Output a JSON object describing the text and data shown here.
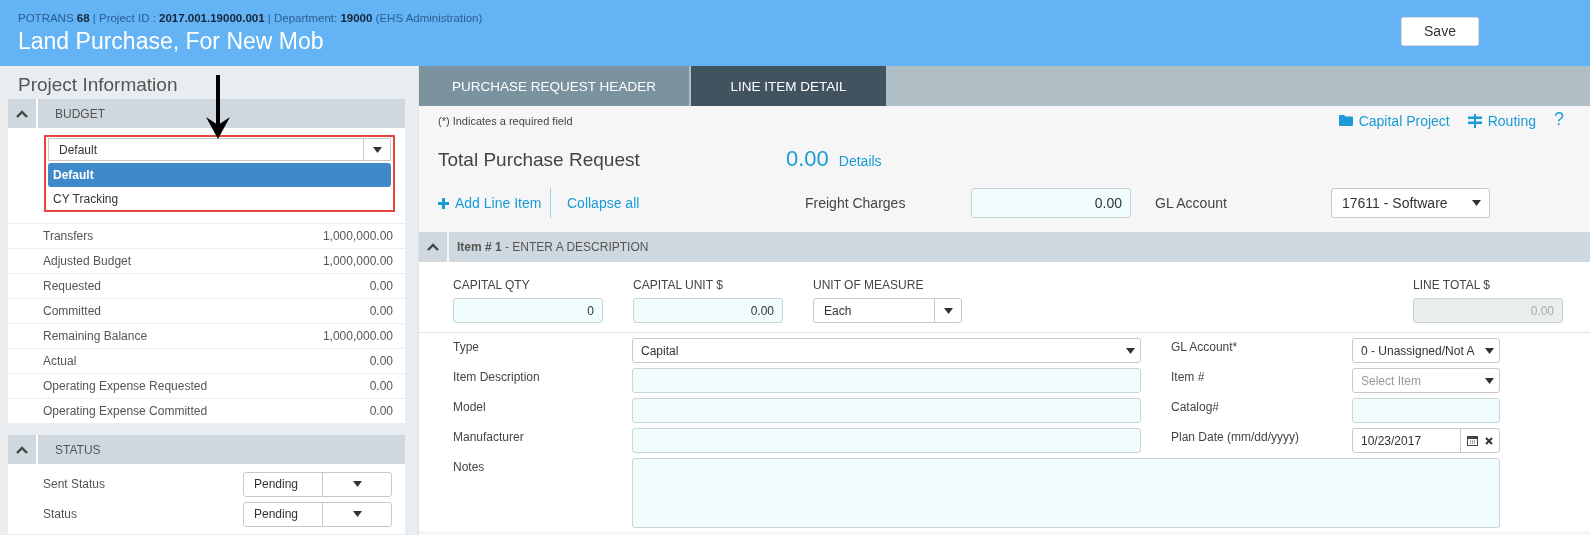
{
  "header": {
    "breadcrumb": "POTRANS **68** | Project ID : **2017.001.19000.001** | Department: **19000** (EHS Administration)",
    "title": "Land Purchase, For New Mob",
    "save_button": "Save"
  },
  "sidebar": {
    "title": "Project Information",
    "budget": {
      "heading": "BUDGET",
      "expanded": true,
      "select": {
        "value": "Default",
        "open": true,
        "options": [
          {
            "label": "Default",
            "selected": true
          },
          {
            "label": "CY Tracking",
            "selected": false
          }
        ]
      },
      "rows": [
        {
          "label": "Transfers",
          "value": "1,000,000.00"
        },
        {
          "label": "Adjusted Budget",
          "value": "1,000,000.00"
        },
        {
          "label": "Requested",
          "value": "0.00"
        },
        {
          "label": "Committed",
          "value": "0.00"
        },
        {
          "label": "Remaining Balance",
          "value": "1,000,000.00"
        },
        {
          "label": "Actual",
          "value": "0.00"
        },
        {
          "label": "Operating Expense Requested",
          "value": "0.00"
        },
        {
          "label": "Operating Expense Committed",
          "value": "0.00"
        }
      ]
    },
    "status": {
      "heading": "STATUS",
      "expanded": true,
      "fields": [
        {
          "label": "Sent Status",
          "value": "Pending"
        },
        {
          "label": "Status",
          "value": "Pending"
        }
      ]
    }
  },
  "tabs": [
    {
      "label": "PURCHASE REQUEST HEADER",
      "selected": false
    },
    {
      "label": "LINE ITEM DETAIL",
      "selected": true
    }
  ],
  "form": {
    "required_note": "(*) Indicates a required field",
    "links": [
      {
        "kind": "folder",
        "label": "Capital Project"
      },
      {
        "kind": "signpost",
        "label": "Routing"
      },
      {
        "kind": "help",
        "label": "?"
      }
    ],
    "total": {
      "label": "Total Purchase Request",
      "amount": "0.00",
      "details_link": "Details"
    },
    "add_link": "Add Line Item",
    "collapse_link": "Collapse all",
    "freight": {
      "label": "Freight Charges",
      "value": "0.00"
    },
    "gl_account": {
      "label": "GL Account",
      "value": "17611 - Software"
    }
  },
  "line_item": {
    "heading": "**Item # 1** - ENTER A DESCRIPTION",
    "expanded": true,
    "top_fields": [
      {
        "label": "CAPITAL QTY",
        "kind": "input",
        "value": "0",
        "disabled": false
      },
      {
        "label": "CAPITAL UNIT $",
        "kind": "input",
        "value": "0.00",
        "disabled": false
      },
      {
        "label": "UNIT OF MEASURE",
        "kind": "select",
        "value": "Each",
        "disabled": false
      },
      {
        "label": "LINE TOTAL $",
        "kind": "input",
        "value": "0.00",
        "disabled": true
      }
    ],
    "left_fields": [
      {
        "label": "Type",
        "kind": "select",
        "value": "Capital"
      },
      {
        "label": "Item Description",
        "kind": "input"
      },
      {
        "label": "Model",
        "kind": "input"
      },
      {
        "label": "Manufacturer",
        "kind": "input"
      }
    ],
    "right_fields": [
      {
        "label": "GL Account*",
        "kind": "select",
        "value": "0 - Unassigned/Not A"
      },
      {
        "label": "Item #",
        "kind": "select",
        "placeholder": "Select Item"
      },
      {
        "label": "Catalog#",
        "kind": "input"
      },
      {
        "label": "Plan Date (mm/dd/yyyy)",
        "kind": "date",
        "value": "10/23/2017"
      }
    ],
    "notes": {
      "label": "Notes"
    }
  }
}
